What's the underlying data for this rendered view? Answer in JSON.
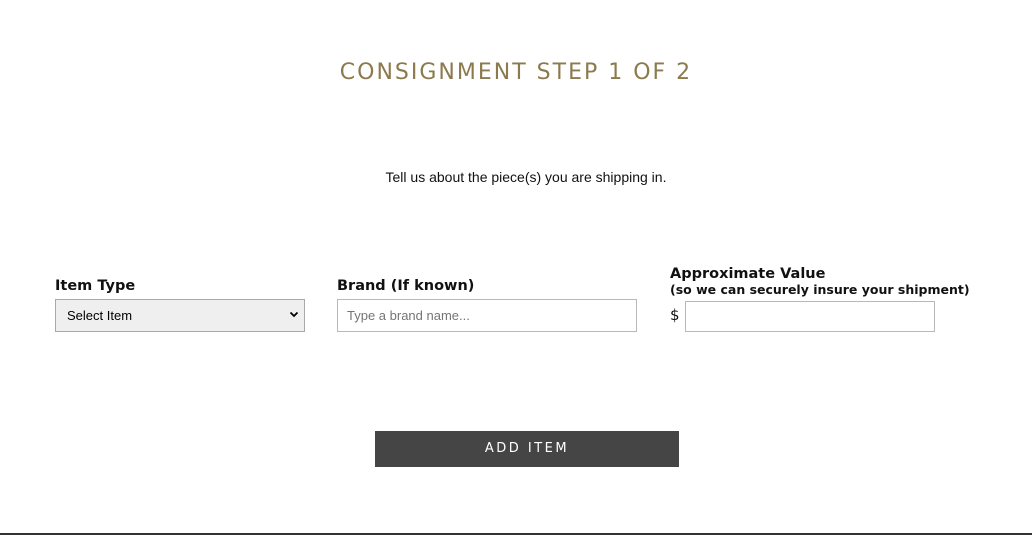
{
  "page": {
    "title": "CONSIGNMENT STEP 1 OF 2",
    "intro": "Tell us about the piece(s) you are shipping in."
  },
  "form": {
    "item_type": {
      "label": "Item Type",
      "selected": "Select Item",
      "chevron_icon": "chevron-down-icon"
    },
    "brand": {
      "label": "Brand (If known)",
      "placeholder": "Type a brand name...",
      "value": ""
    },
    "value": {
      "label": "Approximate Value",
      "sublabel": "(so we can securely insure your shipment)",
      "currency": "$",
      "value": ""
    },
    "add_button": "ADD ITEM"
  },
  "colors": {
    "title": "#8c7a4e",
    "button_bg": "#454545"
  }
}
